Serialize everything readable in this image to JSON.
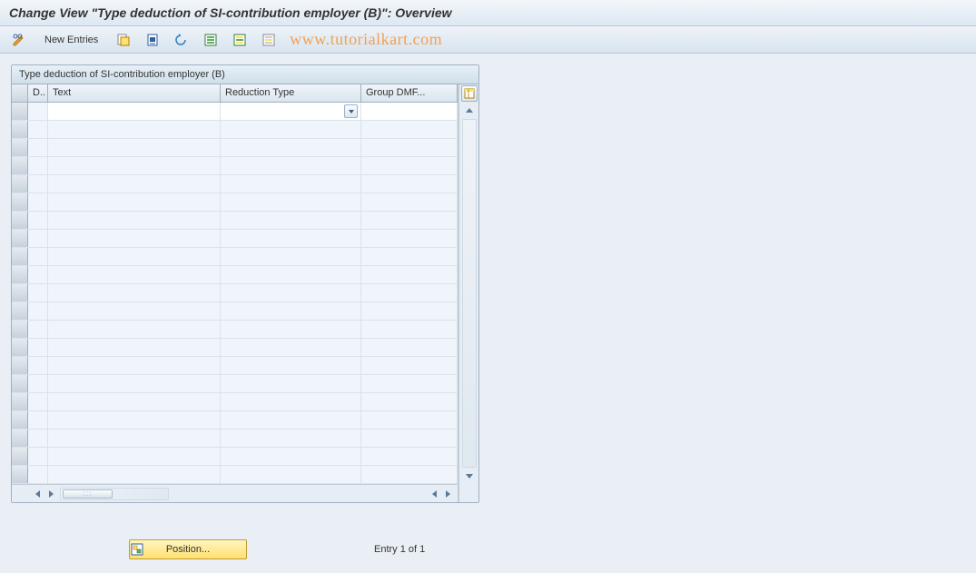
{
  "title": "Change View \"Type deduction of SI-contribution employer (B)\": Overview",
  "toolbar": {
    "new_entries_label": "New Entries"
  },
  "watermark": "www.tutorialkart.com",
  "panel": {
    "title": "Type deduction of SI-contribution employer (B)"
  },
  "columns": {
    "d": "D..",
    "text": "Text",
    "reduction": "Reduction Type",
    "group": "Group DMF..."
  },
  "rows": [
    {
      "d": "",
      "text": "",
      "reduction": "",
      "group": ""
    },
    {
      "d": "",
      "text": "",
      "reduction": "",
      "group": ""
    },
    {
      "d": "",
      "text": "",
      "reduction": "",
      "group": ""
    },
    {
      "d": "",
      "text": "",
      "reduction": "",
      "group": ""
    },
    {
      "d": "",
      "text": "",
      "reduction": "",
      "group": ""
    },
    {
      "d": "",
      "text": "",
      "reduction": "",
      "group": ""
    },
    {
      "d": "",
      "text": "",
      "reduction": "",
      "group": ""
    },
    {
      "d": "",
      "text": "",
      "reduction": "",
      "group": ""
    },
    {
      "d": "",
      "text": "",
      "reduction": "",
      "group": ""
    },
    {
      "d": "",
      "text": "",
      "reduction": "",
      "group": ""
    },
    {
      "d": "",
      "text": "",
      "reduction": "",
      "group": ""
    },
    {
      "d": "",
      "text": "",
      "reduction": "",
      "group": ""
    },
    {
      "d": "",
      "text": "",
      "reduction": "",
      "group": ""
    },
    {
      "d": "",
      "text": "",
      "reduction": "",
      "group": ""
    },
    {
      "d": "",
      "text": "",
      "reduction": "",
      "group": ""
    },
    {
      "d": "",
      "text": "",
      "reduction": "",
      "group": ""
    },
    {
      "d": "",
      "text": "",
      "reduction": "",
      "group": ""
    },
    {
      "d": "",
      "text": "",
      "reduction": "",
      "group": ""
    },
    {
      "d": "",
      "text": "",
      "reduction": "",
      "group": ""
    },
    {
      "d": "",
      "text": "",
      "reduction": "",
      "group": ""
    },
    {
      "d": "",
      "text": "",
      "reduction": "",
      "group": ""
    }
  ],
  "footer": {
    "position_label": "Position...",
    "entry_text": "Entry 1 of 1"
  }
}
